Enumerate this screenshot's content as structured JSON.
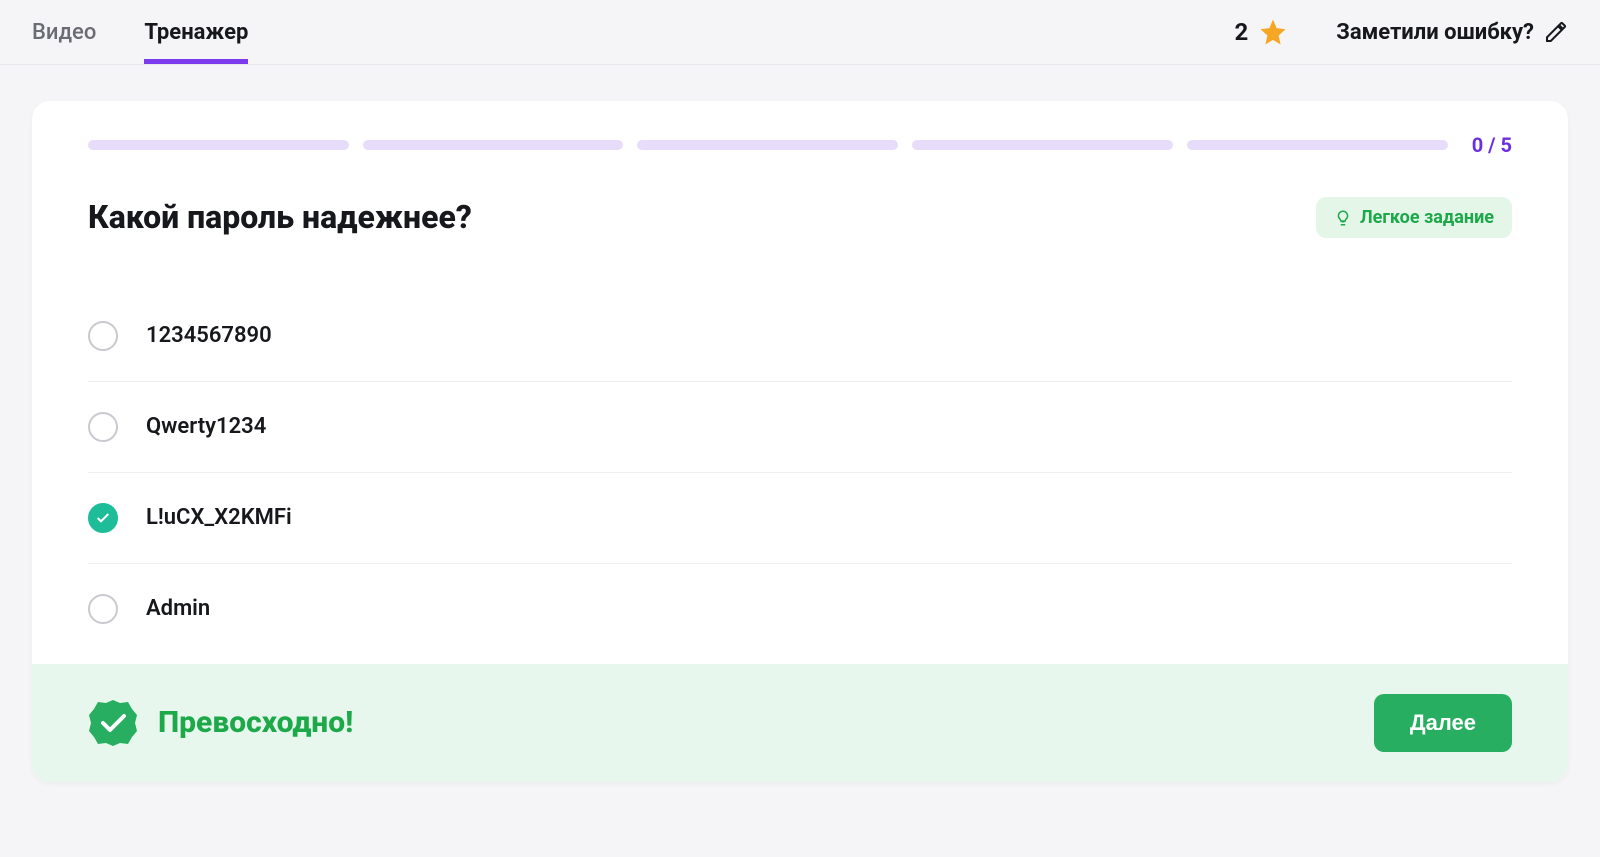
{
  "header": {
    "tabs": [
      {
        "label": "Видео",
        "active": false
      },
      {
        "label": "Тренажер",
        "active": true
      }
    ],
    "score": "2",
    "report_label": "Заметили ошибку?"
  },
  "progress": {
    "current": 0,
    "total": 5,
    "text": "0 / 5",
    "segments": 5
  },
  "question": "Какой пароль надежнее?",
  "difficulty": {
    "label": "Легкое задание"
  },
  "answers": [
    {
      "label": "1234567890",
      "checked": false
    },
    {
      "label": "Qwerty1234",
      "checked": false
    },
    {
      "label": "L!uCX_X2KMFi",
      "checked": true
    },
    {
      "label": "Admin",
      "checked": false
    }
  ],
  "feedback": {
    "text": "Превосходно!"
  },
  "next_button": "Далее"
}
